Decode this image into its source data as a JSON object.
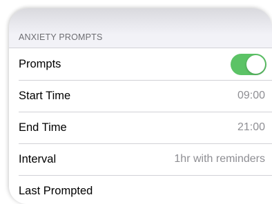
{
  "section": {
    "header": "ANXIETY PROMPTS"
  },
  "rows": [
    {
      "label": "Prompts",
      "control": "toggle",
      "toggle_on": true
    },
    {
      "label": "Start Time",
      "value": "09:00"
    },
    {
      "label": "End Time",
      "value": "21:00"
    },
    {
      "label": "Interval",
      "value": "1hr with reminders"
    },
    {
      "label": "Last Prompted",
      "value": ""
    }
  ],
  "colors": {
    "toggle_on": "#5cc366",
    "background": "#f2f2f7",
    "secondary_text": "#8e8e93"
  }
}
